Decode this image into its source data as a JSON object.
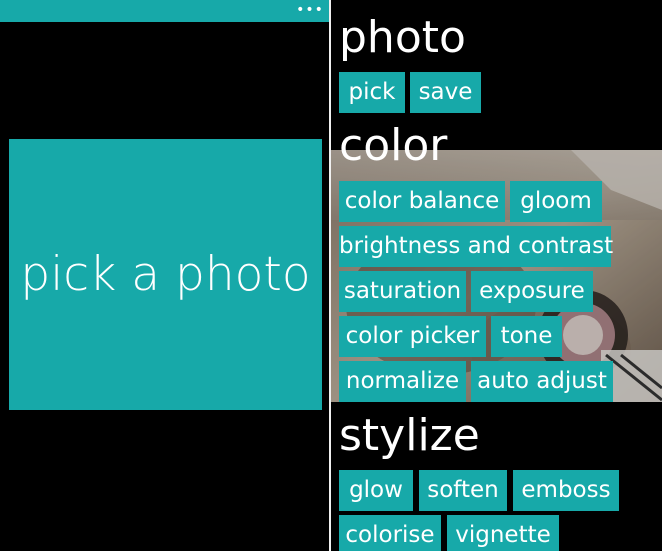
{
  "left": {
    "more_dots": "•••",
    "pick_tile_label": "pick a photo"
  },
  "right": {
    "photo_section": {
      "heading": "photo",
      "buttons": [
        "pick",
        "save"
      ]
    },
    "color_section": {
      "heading": "color",
      "buttons": [
        "color balance",
        "gloom",
        "brightness and contrast",
        "saturation",
        "exposure",
        "color picker",
        "tone",
        "normalize",
        "auto adjust"
      ]
    },
    "stylize_section": {
      "heading": "stylize",
      "buttons": [
        "glow",
        "soften",
        "emboss",
        "colorise",
        "vignette"
      ]
    }
  },
  "colors": {
    "accent": "#17a9a9",
    "background": "#000000",
    "text": "#ffffff"
  }
}
